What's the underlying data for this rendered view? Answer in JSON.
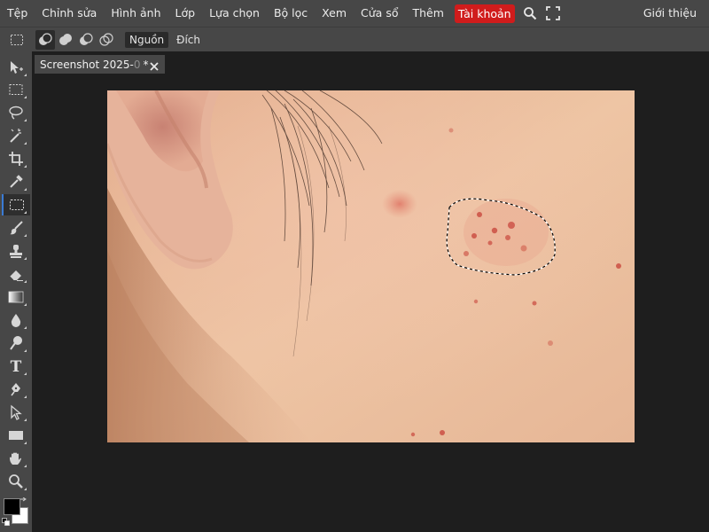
{
  "menu": {
    "items": [
      "Tệp",
      "Chỉnh sửa",
      "Hình ảnh",
      "Lớp",
      "Lựa chọn",
      "Bộ lọc",
      "Xem",
      "Cửa sổ",
      "Thêm"
    ],
    "account_label": "Tài khoản",
    "about_label": "Giới thiệu",
    "icons": [
      "search-icon",
      "fullscreen-icon"
    ]
  },
  "options": {
    "selection_modes": [
      "new-selection-icon",
      "add-to-selection-icon",
      "subtract-from-selection-icon",
      "intersect-selection-icon"
    ],
    "source_label": "Nguồn",
    "destination_label": "Đích",
    "active": "source"
  },
  "toolbar": {
    "tools": [
      "move-tool",
      "marquee-tool",
      "lasso-tool",
      "magic-wand-tool",
      "crop-tool",
      "eyedropper-tool",
      "patch-tool",
      "brush-tool",
      "clone-stamp-tool",
      "eraser-tool",
      "gradient-tool",
      "blur-tool",
      "dodge-tool",
      "text-tool",
      "pen-tool",
      "path-select-tool",
      "shape-tool",
      "hand-tool",
      "zoom-tool"
    ],
    "active_tool": "patch-tool",
    "foreground_color": "#000000",
    "background_color": "#ffffff"
  },
  "document": {
    "tab_title": "Screenshot 2025-",
    "tab_title_faded": "0",
    "modified_mark": "*"
  },
  "colors": {
    "chrome": "#474747",
    "workspace": "#1e1e1e",
    "account_accent": "#d01c1c",
    "active_tool_accent": "#3a7bd5"
  }
}
